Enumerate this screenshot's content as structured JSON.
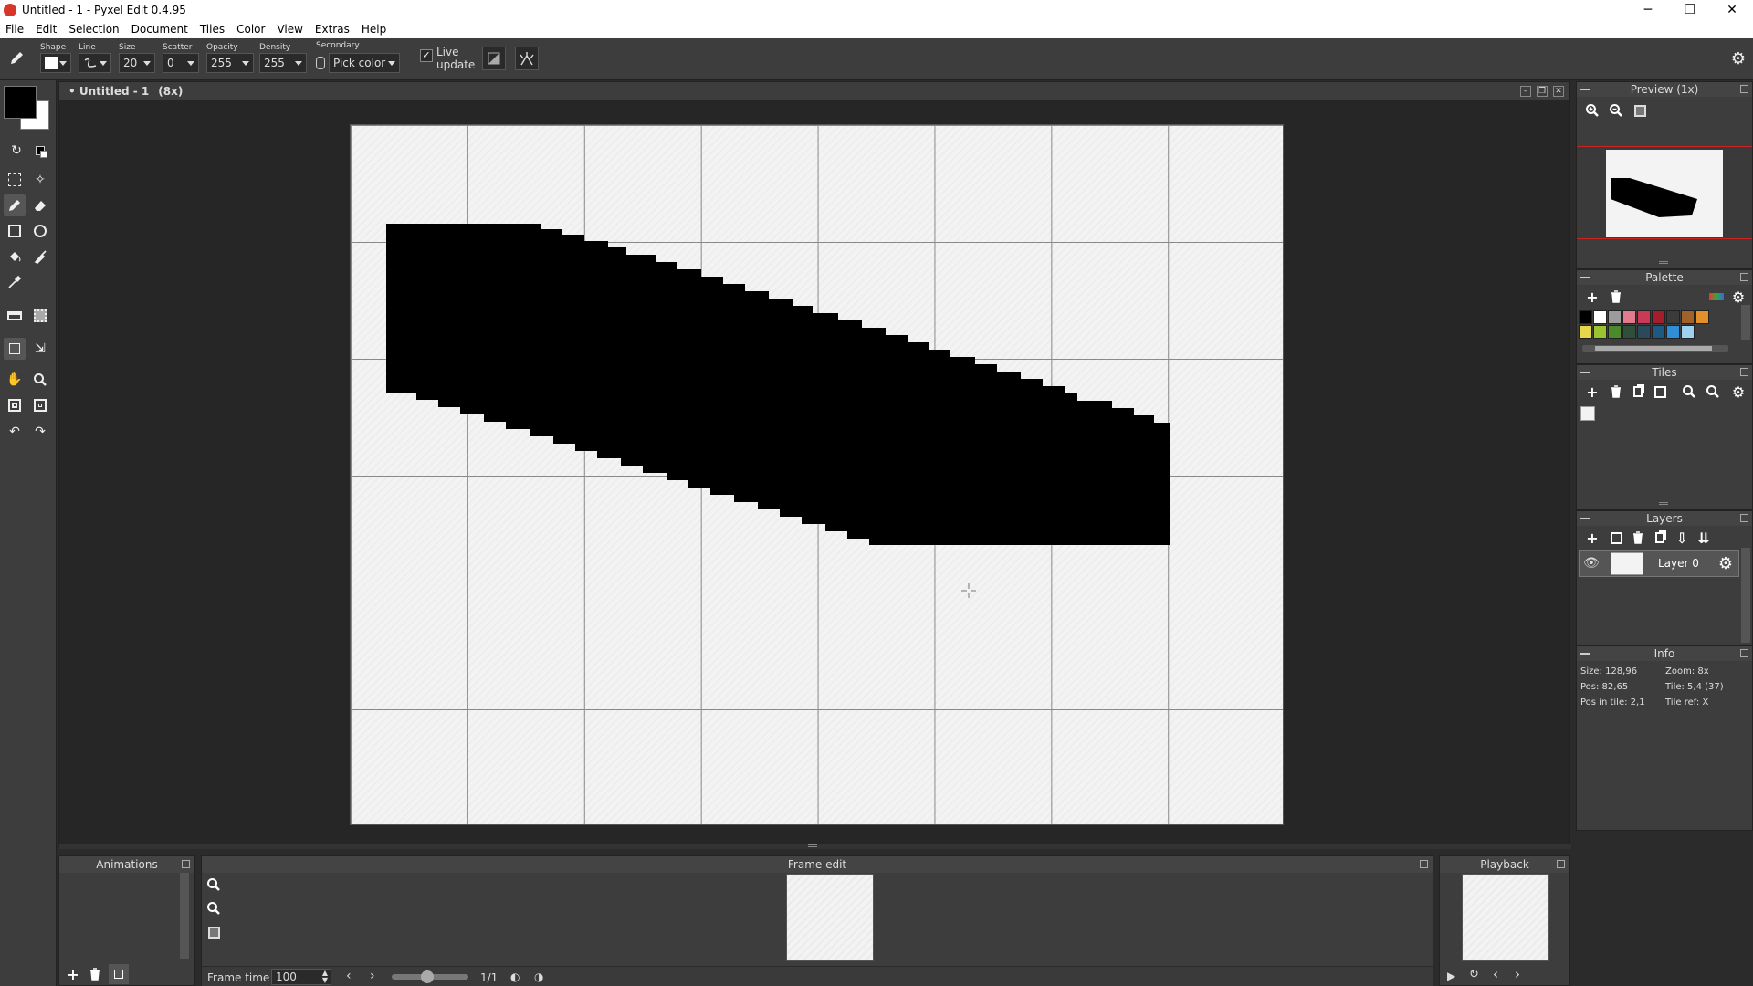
{
  "window": {
    "title": "Untitled - 1 - Pyxel Edit 0.4.95",
    "minimize": "─",
    "maximize": "❐",
    "close": "✕"
  },
  "menu": [
    "File",
    "Edit",
    "Selection",
    "Document",
    "Tiles",
    "Color",
    "View",
    "Extras",
    "Help"
  ],
  "toolbar": {
    "shape_label": "Shape",
    "line_label": "Line",
    "size_label": "Size",
    "size_value": "20",
    "scatter_label": "Scatter",
    "scatter_value": "0",
    "opacity_label": "Opacity",
    "opacity_value": "255",
    "density_label": "Density",
    "density_value": "255",
    "secondary_label": "Secondary",
    "secondary_value": "Pick color",
    "live_update_label": "Live update",
    "live_update_checked": true
  },
  "document": {
    "title": "• Untitled - 1",
    "zoom": "(8x)"
  },
  "panels": {
    "preview": {
      "title": "Preview (1x)"
    },
    "palette": {
      "title": "Palette",
      "colors": [
        "#000000",
        "#ffffff",
        "#9c9c9c",
        "#e07a8c",
        "#c83a55",
        "#a31d2c",
        "#3b3b3b",
        "#a0622a",
        "#e3902b",
        "#e6d84a",
        "#9cc32f",
        "#4a8a2c",
        "#2f4f3a",
        "#2a4a5a",
        "#1c5a82",
        "#2f8fd6",
        "#9fd0f0"
      ]
    },
    "tiles": {
      "title": "Tiles"
    },
    "layers": {
      "title": "Layers",
      "items": [
        {
          "name": "Layer 0"
        }
      ]
    },
    "info": {
      "title": "Info",
      "size": "Size: 128,96",
      "zoom": "Zoom: 8x",
      "pos": "Pos: 82,65",
      "tile": "Tile: 5,4 (37)",
      "pos_in_tile": "Pos in tile: 2,1",
      "tile_ref": "Tile ref: X"
    }
  },
  "bottom": {
    "animations": {
      "title": "Animations"
    },
    "frame_edit": {
      "title": "Frame edit",
      "frame_time_label": "Frame time",
      "frame_time_value": "100",
      "frame_counter": "1/1"
    },
    "playback": {
      "title": "Playback"
    }
  },
  "canvas": {
    "background": "#f3f3f3",
    "ink": "#000000"
  }
}
